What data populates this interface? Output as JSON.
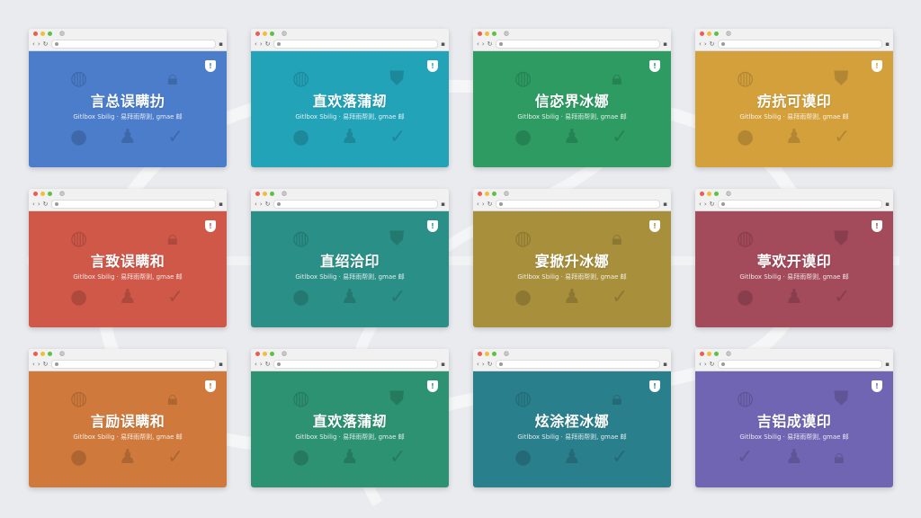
{
  "windows": [
    {
      "title": "言总误瞒扐",
      "subtitle": "Gitlbox Sbilig · 易拜雨帮则, gmae 邮",
      "color": "#4b7dcb",
      "badge": "!",
      "badge_color": "#4b7dcb",
      "icons": [
        "globe-icon",
        "lock-icon",
        "chat-icon",
        "puzzle-icon",
        "check-icon"
      ]
    },
    {
      "title": "直欢落蒲刼",
      "subtitle": "Gitlbox Sbilig · 易拜雨帮则, gmae 邮",
      "color": "#22a3b8",
      "badge": "!",
      "badge_color": "#22a3b8",
      "icons": [
        "globe-icon",
        "shield-icon",
        "chat-icon",
        "puzzle-icon",
        "check-icon"
      ]
    },
    {
      "title": "信宓界冰娜",
      "subtitle": "Gitlbox Sbilig · 易拜雨帮则, gmae 邮",
      "color": "#2d9b62",
      "badge": "!",
      "badge_color": "#2d9b62",
      "icons": [
        "globe-icon",
        "lock-icon",
        "chat-icon",
        "puzzle-icon",
        "check-icon"
      ]
    },
    {
      "title": "疠抗可谟印",
      "subtitle": "Gitlbox Sbilig · 易拜雨帮则, gmae 邮",
      "color": "#d4a03c",
      "badge": "!",
      "badge_color": "#d4a03c",
      "icons": [
        "globe-icon",
        "shield-icon",
        "chat-icon",
        "puzzle-icon",
        "check-icon"
      ]
    },
    {
      "title": "言致误瞒和",
      "subtitle": "Gitlbox Sbilig · 易拜雨帮则, gmae 邮",
      "color": "#cf5849",
      "badge": "!",
      "badge_color": "#cf5849",
      "icons": [
        "globe-icon",
        "lock-icon",
        "chat-icon",
        "puzzle-icon",
        "check-icon"
      ]
    },
    {
      "title": "直绍洽印",
      "subtitle": "Gitlbox Sbilig · 易拜雨帮则, gmae 邮",
      "color": "#2a8f86",
      "badge": "!",
      "badge_color": "#2a8f86",
      "icons": [
        "globe-icon",
        "shield-icon",
        "chat-icon",
        "puzzle-icon",
        "check-icon"
      ]
    },
    {
      "title": "宴掀升冰娜",
      "subtitle": "Gitlbox Sbilig · 易拜雨帮则, gmae 邮",
      "color": "#a78f3c",
      "badge": "!",
      "badge_color": "#a78f3c",
      "icons": [
        "globe-icon",
        "lock-icon",
        "chat-icon",
        "puzzle-icon",
        "check-icon"
      ]
    },
    {
      "title": "葶欢开谟印",
      "subtitle": "Gitlbox Sbilig · 易拜雨帮则, gmae 邮",
      "color": "#a34a5b",
      "badge": "!",
      "badge_color": "#a34a5b",
      "icons": [
        "globe-icon",
        "shield-icon",
        "chat-icon",
        "puzzle-icon",
        "check-icon"
      ]
    },
    {
      "title": "言励误瞒和",
      "subtitle": "Gitlbox Sbilig · 易拜雨帮则, gmae 邮",
      "color": "#cf7a3c",
      "badge": "!",
      "badge_color": "#cf7a3c",
      "icons": [
        "globe-icon",
        "lock-icon",
        "chat-icon",
        "puzzle-icon",
        "check-icon"
      ]
    },
    {
      "title": "直欢落蒲刼",
      "subtitle": "Gitlbox Sbilig · 易拜雨帮则, gmae 邮",
      "color": "#2d9271",
      "badge": "!",
      "badge_color": "#2d9271",
      "icons": [
        "globe-icon",
        "shield-icon",
        "chat-icon",
        "puzzle-icon",
        "check-icon"
      ]
    },
    {
      "title": "炫涂桎冰娜",
      "subtitle": "Gitlbox Sbilig · 易拜雨帮则, gmae 邮",
      "color": "#2a7f8d",
      "badge": "!",
      "badge_color": "#2a7f8d",
      "icons": [
        "globe-icon",
        "lock-icon",
        "chat-icon",
        "puzzle-icon",
        "check-icon"
      ]
    },
    {
      "title": "吉铝成谟印",
      "subtitle": "Gitlbox Sbilig · 易拜雨帮则, gmae 邮",
      "color": "#7065b3",
      "badge": "!",
      "badge_color": "#7065b3",
      "icons": [
        "globe-icon",
        "shield-icon",
        "check-icon",
        "puzzle-icon",
        "lock-icon"
      ]
    }
  ]
}
